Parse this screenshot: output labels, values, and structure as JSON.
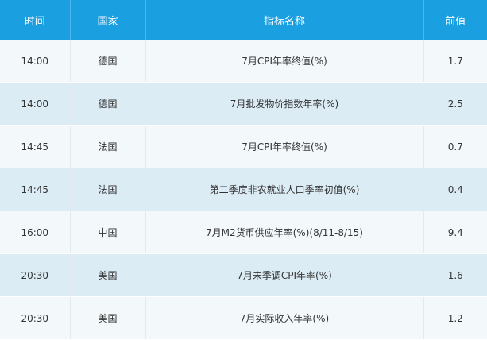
{
  "table": {
    "headers": [
      "时间",
      "国家",
      "指标名称",
      "前值"
    ],
    "rows": [
      {
        "time": "14:00",
        "country": "德国",
        "indicator": "7月CPI年率终值(%)",
        "previous": "1.7"
      },
      {
        "time": "14:00",
        "country": "德国",
        "indicator": "7月批发物价指数年率(%)",
        "previous": "2.5"
      },
      {
        "time": "14:45",
        "country": "法国",
        "indicator": "7月CPI年率终值(%)",
        "previous": "0.7"
      },
      {
        "time": "14:45",
        "country": "法国",
        "indicator": "第二季度非农就业人口季率初值(%)",
        "previous": "0.4"
      },
      {
        "time": "16:00",
        "country": "中国",
        "indicator": "7月M2货币供应年率(%)(8/11-8/15)",
        "previous": "9.4"
      },
      {
        "time": "20:30",
        "country": "美国",
        "indicator": "7月未季调CPI年率(%)",
        "previous": "1.6"
      },
      {
        "time": "20:30",
        "country": "美国",
        "indicator": "7月实际收入年率(%)",
        "previous": "1.2"
      }
    ]
  },
  "colors": {
    "header_bg": "#1a9fe0",
    "header_text": "#ffffff",
    "row_odd_bg": "#f3f8fb",
    "row_even_bg": "#dcecf5",
    "cell_text": "#333333"
  }
}
